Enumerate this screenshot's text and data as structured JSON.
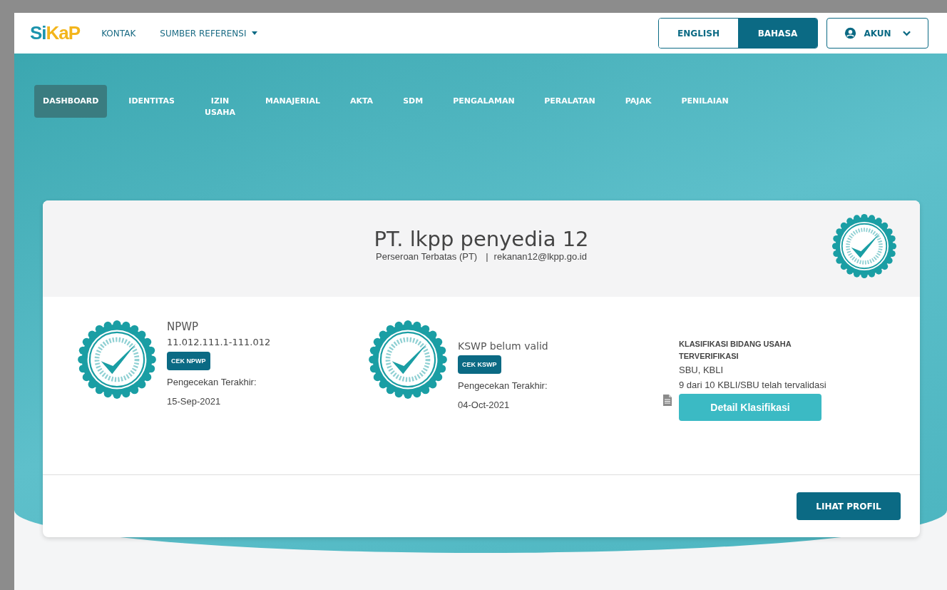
{
  "header": {
    "logo": {
      "part_1": "Si",
      "part_2": "KaP"
    },
    "links": [
      {
        "label": "KONTAK",
        "kind": "link"
      },
      {
        "label": "SUMBER REFERENSI",
        "kind": "dropdown"
      }
    ],
    "languages": [
      {
        "label": "ENGLISH",
        "selected": false
      },
      {
        "label": "BAHASA",
        "selected": true
      }
    ],
    "account": {
      "label": "AKUN"
    }
  },
  "tabs": [
    {
      "label": "DASHBOARD",
      "selected": true
    },
    {
      "label": "IDENTITAS",
      "selected": false
    },
    {
      "label": "IZIN USAHA",
      "selected": false
    },
    {
      "label": "MANAJERIAL",
      "selected": false
    },
    {
      "label": "AKTA",
      "selected": false
    },
    {
      "label": "SDM",
      "selected": false
    },
    {
      "label": "PENGALAMAN",
      "selected": false
    },
    {
      "label": "PERALATAN",
      "selected": false
    },
    {
      "label": "PAJAK",
      "selected": false
    },
    {
      "label": "PENILAIAN",
      "selected": false
    }
  ],
  "profile": {
    "name": "PT. lkpp penyedia 12",
    "type": "Perseroan Terbatas (PT)",
    "separator": "|",
    "email": "rekanan12@lkpp.go.id"
  },
  "checks": [
    {
      "title": "NPWP",
      "value": "11.012.111.1-111.012",
      "button": "CEK NPWP",
      "caption": "Pengecekan Terakhir:",
      "date": "15-Sep-2021"
    },
    {
      "title": "KSWP belum valid",
      "button": "CEK KSWP",
      "caption": "Pengecekan Terakhir:",
      "date": "04-Oct-2021"
    }
  ],
  "classification": {
    "title": "KLASIFIKASI BIDANG USAHA TERVERIFIKASI",
    "types": "SBU, KBLI",
    "status": "9 dari 10 KBLI/SBU telah tervalidasi",
    "button": "Detail Klasifikasi"
  },
  "footer": {
    "button": "LIHAT PROFIL"
  }
}
